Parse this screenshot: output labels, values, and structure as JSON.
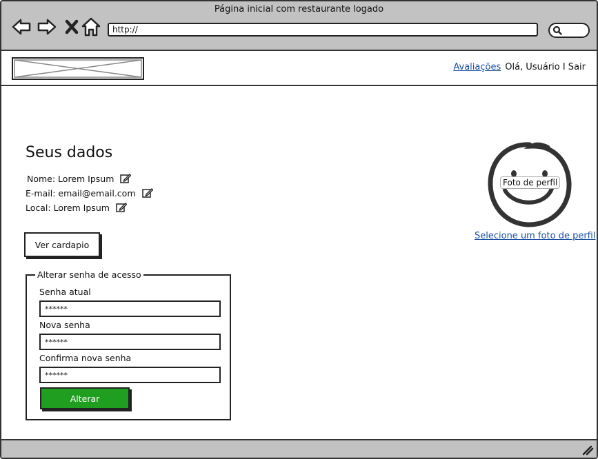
{
  "window": {
    "title": "Página inicial com restaurante logado"
  },
  "browser": {
    "url": "http://",
    "icons": [
      "back-arrow-icon",
      "forward-arrow-icon",
      "close-x-icon",
      "home-icon",
      "search-icon"
    ]
  },
  "header": {
    "nav_link": "Avaliações",
    "greeting": "Olá, Usuário I Sair"
  },
  "profile": {
    "title": "Seus dados",
    "fields": [
      {
        "text": "Nome: Lorem Ipsum",
        "icon": "edit-icon"
      },
      {
        "text": "E-mail: email@email.com",
        "icon": "edit-icon"
      },
      {
        "text": "Local: Lorem Ipsum",
        "icon": "edit-icon"
      }
    ],
    "menu_button": "Ver cardapio"
  },
  "password": {
    "legend": "Alterar senha de acesso",
    "current_label": "Senha atual",
    "current_value": "******",
    "new_label": "Nova senha",
    "new_value": "******",
    "confirm_label": "Confirma nova senha",
    "confirm_value": "******",
    "submit_label": "Alterar"
  },
  "photo": {
    "label": "Foto de perfil",
    "link": "Selecione um foto de perfil"
  },
  "colors": {
    "accent": "#1f9e1f",
    "link": "#1a4fa0",
    "chrome": "#c2c2c2"
  }
}
